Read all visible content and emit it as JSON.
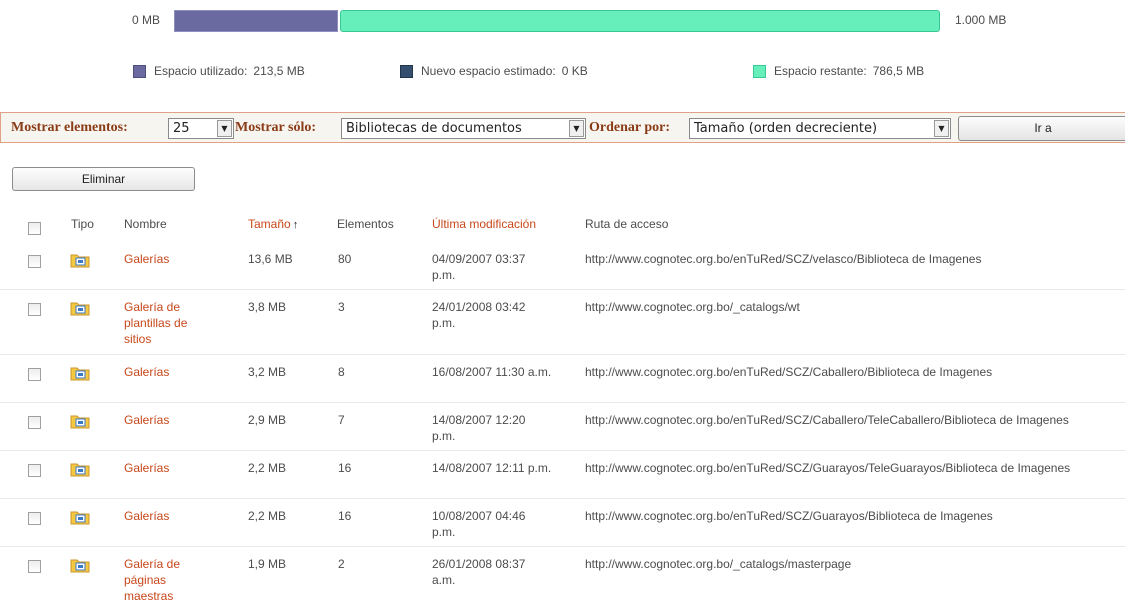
{
  "storage": {
    "min_label": "0 MB",
    "max_label": "1.000 MB",
    "used_fraction": 0.2135,
    "free_fraction": 0.7865,
    "legend": [
      {
        "label": "Espacio utilizado:",
        "value": "213,5 MB",
        "color": "#6a6aa0"
      },
      {
        "label": "Nuevo espacio estimado:",
        "value": "0 KB",
        "color": "#34506e"
      },
      {
        "label": "Espacio restante:",
        "value": "786,5 MB",
        "color": "#66eebb"
      }
    ]
  },
  "toolbar": {
    "show_items_label": "Mostrar elementos:",
    "show_items_value": "25",
    "show_only_label": "Mostrar sólo:",
    "show_only_value": "Bibliotecas de documentos",
    "sort_label": "Ordenar por:",
    "sort_value": "Tamaño (orden decreciente)",
    "go_label": "Ir a"
  },
  "actions": {
    "delete_label": "Eliminar"
  },
  "table": {
    "columns": {
      "type": "Tipo",
      "name": "Nombre",
      "size": "Tamaño",
      "items": "Elementos",
      "modified": "Última modificación",
      "path": "Ruta de acceso"
    },
    "sort_arrow": "↑",
    "rows": [
      {
        "name": "Galerías",
        "size": "13,6 MB",
        "items": "80",
        "modified": "04/09/2007 03:37 p.m.",
        "path": "http://www.cognotec.org.bo/enTuRed/SCZ/velasco/Biblioteca de Imagenes"
      },
      {
        "name": "Galería de plantillas de sitios",
        "size": "3,8 MB",
        "items": "3",
        "modified": "24/01/2008 03:42 p.m.",
        "path": "http://www.cognotec.org.bo/_catalogs/wt"
      },
      {
        "name": "Galerías",
        "size": "3,2 MB",
        "items": "8",
        "modified": "16/08/2007 11:30 a.m.",
        "path": "http://www.cognotec.org.bo/enTuRed/SCZ/Caballero/Biblioteca de Imagenes"
      },
      {
        "name": "Galerías",
        "size": "2,9 MB",
        "items": "7",
        "modified": "14/08/2007 12:20 p.m.",
        "path": "http://www.cognotec.org.bo/enTuRed/SCZ/Caballero/TeleCaballero/Biblioteca de Imagenes"
      },
      {
        "name": "Galerías",
        "size": "2,2 MB",
        "items": "16",
        "modified": "14/08/2007 12:11 p.m.",
        "path": "http://www.cognotec.org.bo/enTuRed/SCZ/Guarayos/TeleGuarayos/Biblioteca de Imagenes"
      },
      {
        "name": "Galerías",
        "size": "2,2 MB",
        "items": "16",
        "modified": "10/08/2007 04:46 p.m.",
        "path": "http://www.cognotec.org.bo/enTuRed/SCZ/Guarayos/Biblioteca de Imagenes"
      },
      {
        "name": "Galería de páginas maestras",
        "size": "1,9 MB",
        "items": "2",
        "modified": "26/01/2008 08:37 a.m.",
        "path": "http://www.cognotec.org.bo/_catalogs/masterpage"
      }
    ],
    "row_icon": "folder-library-icon"
  }
}
